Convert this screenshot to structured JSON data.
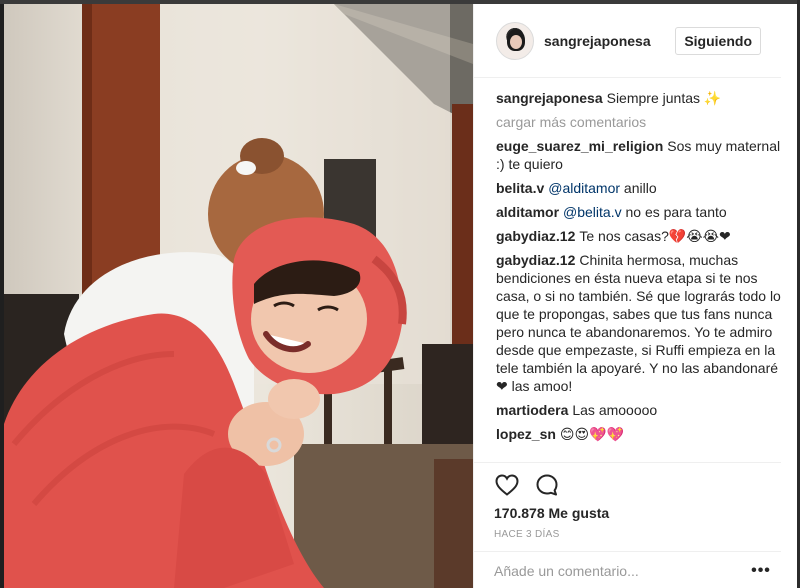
{
  "post": {
    "username": "sangrejaponesa",
    "follow_label": "Siguiendo",
    "caption": {
      "user": "sangrejaponesa",
      "text": "Siempre juntas ✨"
    },
    "load_more": "cargar más comentarios",
    "comments": [
      {
        "user": "euge_suarez_mi_religion",
        "text": "Sos muy maternal :) te quiero"
      },
      {
        "user": "belita.v",
        "mention": "@alditamor",
        "text": " anillo"
      },
      {
        "user": "alditamor",
        "mention": "@belita.v",
        "text": " no es para tanto"
      },
      {
        "user": "gabydiaz.12",
        "text": "Te nos casas?💔😭😭❤"
      },
      {
        "user": "gabydiaz.12",
        "text": "Chinita hermosa, muchas bendiciones en ésta nueva etapa si te nos casa, o si no también. Sé que lograrás todo lo que te propongas, sabes que tus fans nunca pero nunca te abandonaremos. Yo te admiro desde que empezaste, si Ruffi empieza en la tele también la apoyaré. Y no las abandonaré ❤ las amoo!"
      },
      {
        "user": "martiodera",
        "text": "Las amooooo"
      },
      {
        "user": "lopez_sn",
        "text": "😊😍💖💖"
      }
    ],
    "likes": "170.878 Me gusta",
    "time": "HACE 3 DÍAS",
    "add_comment_placeholder": "Añade un comentario...",
    "more_label": "•••"
  },
  "icons": {
    "like": "heart-icon",
    "comment": "comment-icon",
    "avatar": "avatar"
  }
}
